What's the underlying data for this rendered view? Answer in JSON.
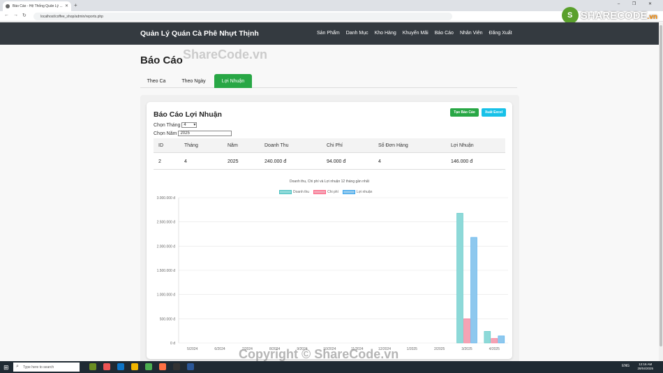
{
  "browser": {
    "tab_title": "Báo Cáo - Hệ Thống Quản Lý ...",
    "url": "localhost/coffee_shop/admin/reports.php"
  },
  "logo": {
    "text": "SHARECODE",
    "suffix": ".vn"
  },
  "navbar": {
    "brand": "Quản Lý Quán Cà Phê Nhựt Thịnh",
    "links": [
      "Sản Phẩm",
      "Danh Mục",
      "Kho Hàng",
      "Khuyến Mãi",
      "Báo Cáo",
      "Nhân Viên",
      "Đăng Xuất"
    ]
  },
  "page": {
    "title": "Báo Cáo",
    "watermark_top": "ShareCode.vn",
    "watermark_bottom": "Copyright © ShareCode.vn"
  },
  "tabs": [
    {
      "label": "Theo Ca",
      "active": false
    },
    {
      "label": "Theo Ngày",
      "active": false
    },
    {
      "label": "Lợi Nhuận",
      "active": true
    }
  ],
  "report": {
    "title": "Báo Cáo Lợi Nhuận",
    "create_button": "Tạo Báo Cáo",
    "excel_button": "Xuất Excel",
    "month_label": "Chọn Tháng",
    "month_value": "4",
    "year_label": "Chọn Năm",
    "year_value": "2025"
  },
  "table": {
    "headers": [
      "ID",
      "Tháng",
      "Năm",
      "Doanh Thu",
      "Chi Phí",
      "Số Đơn Hàng",
      "Lợi Nhuận"
    ],
    "rows": [
      [
        "2",
        "4",
        "2025",
        "240.000 đ",
        "94.000 đ",
        "4",
        "146.000 đ"
      ]
    ]
  },
  "colors": {
    "navbar": "#343a40",
    "active_tab": "#28a745",
    "excel_button": "#17c1e8",
    "revenue": "#8dd9d8",
    "cost": "#f4a3b4",
    "profit": "#8ec8ee"
  },
  "chart_data": {
    "type": "bar",
    "title": "Doanh thu, Chi phí và Lợi nhuận 12 tháng gần nhất",
    "categories": [
      "5/2024",
      "6/2024",
      "7/2024",
      "8/2024",
      "9/2024",
      "10/2024",
      "11/2024",
      "12/2024",
      "1/2025",
      "2/2025",
      "3/2025",
      "4/2025"
    ],
    "series": [
      {
        "name": "Doanh thu",
        "color": "#8dd9d8",
        "values": [
          0,
          0,
          0,
          0,
          0,
          0,
          0,
          0,
          0,
          0,
          2680000,
          240000
        ]
      },
      {
        "name": "Chi phí",
        "color": "#f4a3b4",
        "values": [
          0,
          0,
          0,
          0,
          0,
          0,
          0,
          0,
          0,
          0,
          500000,
          94000
        ]
      },
      {
        "name": "Lợi nhuận",
        "color": "#8ec8ee",
        "values": [
          0,
          0,
          0,
          0,
          0,
          0,
          0,
          0,
          0,
          0,
          2180000,
          146000
        ]
      }
    ],
    "yticks": [
      "0 đ",
      "500.000 đ",
      "1.000.000 đ",
      "1.500.000 đ",
      "2.000.000 đ",
      "2.500.000 đ",
      "3.000.000 đ"
    ],
    "ylim": [
      0,
      3000000
    ],
    "grid": true,
    "legend": "top-center"
  },
  "taskbar": {
    "search_placeholder": "Type here to search",
    "time": "12:16 AM",
    "date": "28/04/2025",
    "lang": "ENG"
  }
}
